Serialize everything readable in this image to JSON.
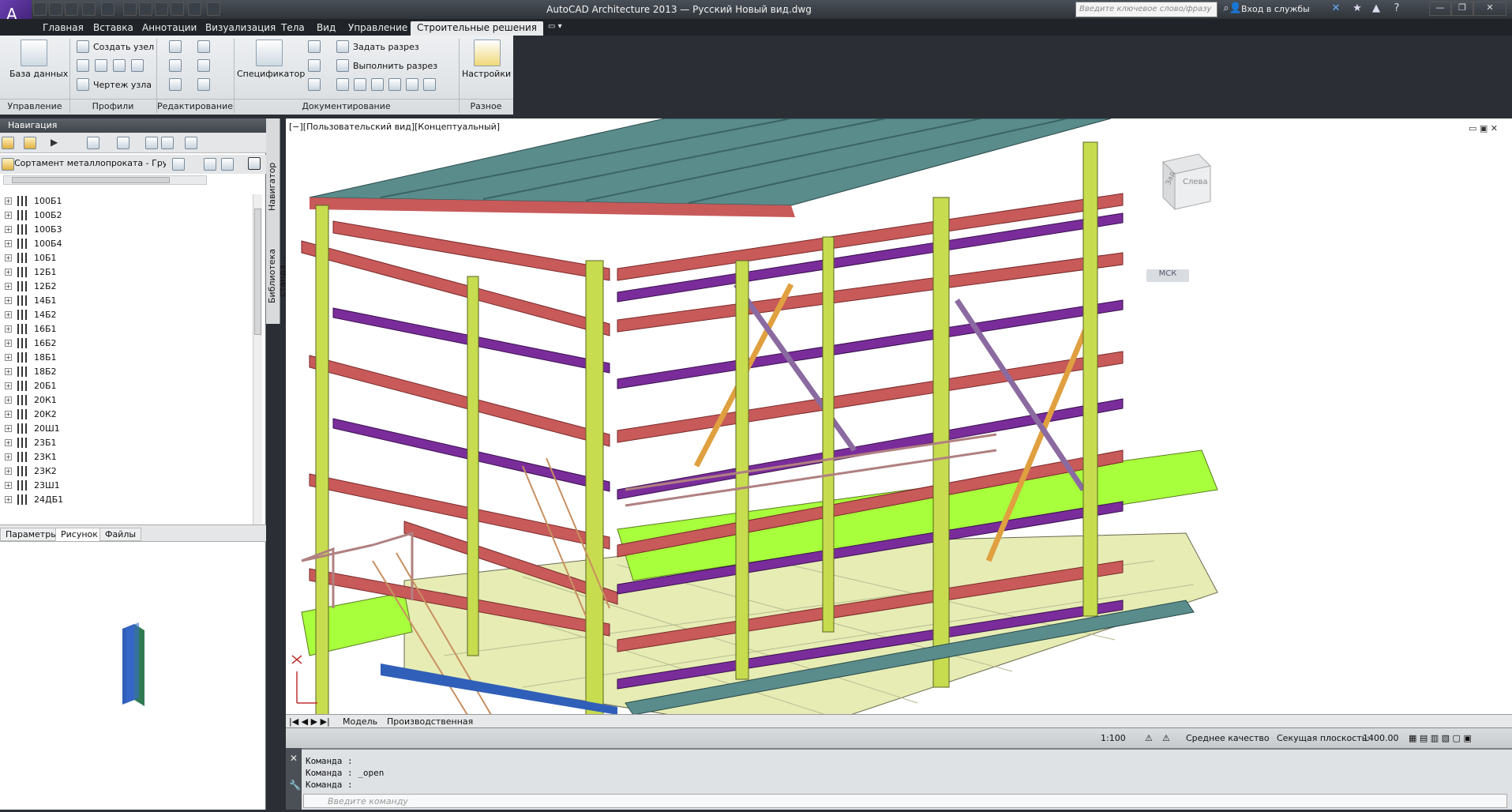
{
  "titlebar": {
    "title": "AutoCAD Architecture 2013 — Русский    Новый вид.dwg",
    "search_placeholder": "Введите ключевое слово/фразу",
    "sign_in": "Вход в службы",
    "logo_letter": "A"
  },
  "tabs": [
    "Главная",
    "Вставка",
    "Аннотации",
    "Визуализация",
    "Тела",
    "Вид",
    "Управление",
    "Строительные решения"
  ],
  "active_tab": "Строительные решения",
  "ribbon": {
    "database_label": "База данных",
    "create_node": "Создать узел",
    "node_drawing": "Чертеж узла",
    "specifier": "Спецификатор",
    "set_section": "Задать разрез",
    "make_section": "Выполнить разрез",
    "settings": "Настройки",
    "panels": [
      "Управление",
      "Профили",
      "Редактирование",
      "Документирование",
      "Разное"
    ]
  },
  "navigator": {
    "title": "Навигация",
    "selector": "Сортамент металлопроката - Груп...",
    "side_tabs": [
      "Навигатор",
      "Библиотека станда..."
    ],
    "items": [
      "100Б1",
      "100Б2",
      "100Б3",
      "100Б4",
      "10Б1",
      "12Б1",
      "12Б2",
      "14Б1",
      "14Б2",
      "16Б1",
      "16Б2",
      "18Б1",
      "18Б2",
      "20Б1",
      "20К1",
      "20К2",
      "20Ш1",
      "23Б1",
      "23К1",
      "23К2",
      "23Ш1",
      "24ДБ1"
    ],
    "lower_tabs": [
      "Параметры",
      "Рисунок",
      "Файлы"
    ],
    "active_lower_tab": "Рисунок"
  },
  "viewport": {
    "label": "[−][Пользовательский вид][Концептуальный]",
    "cube_left": "Зад",
    "cube_right": "Слева",
    "ucs": "МСК"
  },
  "layout_tabs": [
    "Модель",
    "Производственная"
  ],
  "statusbar": {
    "scale": "1:100",
    "quality": "Среднее качество",
    "cut_plane_label": "Секущая плоскость:",
    "cut_plane_value": "1400.00"
  },
  "command": {
    "lines": [
      "Команда :",
      "Команда :  _open",
      "Команда :"
    ],
    "input_placeholder": "Введите команду"
  },
  "colors": {
    "beam_red": "#c85a5a",
    "column_green": "#c8dc50",
    "bracing_purple": "#7a2d9a",
    "roof_teal": "#5a8c8c",
    "floor_yellow": "#e6ecb4",
    "bright_green": "#a8ff3c"
  }
}
